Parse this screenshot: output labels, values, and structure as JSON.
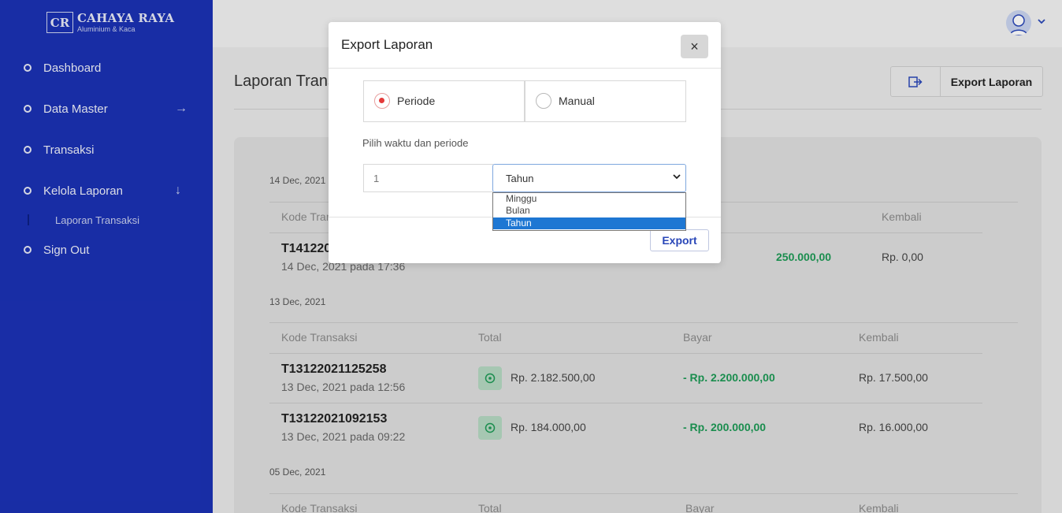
{
  "brand": {
    "logo_mark": "CR",
    "name": "CAHAYA RAYA",
    "tagline": "Aluminium & Kaca"
  },
  "sidebar": {
    "items": [
      {
        "label": "Dashboard",
        "arrow": ""
      },
      {
        "label": "Data Master",
        "arrow": "→"
      },
      {
        "label": "Transaksi",
        "arrow": ""
      },
      {
        "label": "Kelola Laporan",
        "arrow": "↓"
      },
      {
        "label": "Sign Out",
        "arrow": ""
      }
    ],
    "subitem": "Laporan Transaksi"
  },
  "header": {
    "page_title": "Laporan Transaksi",
    "export_button": "Export Laporan",
    "avatar_icon": "user-avatar-icon"
  },
  "report": {
    "columns": {
      "code": "Kode Transaksi",
      "total": "Total",
      "bayar": "Bayar",
      "kembali": "Kembali"
    },
    "groups": [
      {
        "date": "14 Dec, 2021",
        "rows": [
          {
            "code": "T141220",
            "when": "14 Dec, 2021 pada 17:36",
            "bayar": "250.000,00",
            "kembali": "Rp. 0,00"
          }
        ]
      },
      {
        "date": "13 Dec, 2021",
        "rows": [
          {
            "code": "T13122021125258",
            "when": "13 Dec, 2021 pada 12:56",
            "total": "Rp. 2.182.500,00",
            "bayar": "- Rp. 2.200.000,00",
            "kembali": "Rp. 17.500,00"
          },
          {
            "code": "T13122021092153",
            "when": "13 Dec, 2021 pada 09:22",
            "total": "Rp. 184.000,00",
            "bayar": "- Rp. 200.000,00",
            "kembali": "Rp. 16.000,00"
          }
        ]
      },
      {
        "date": "05 Dec, 2021",
        "rows": []
      }
    ]
  },
  "modal": {
    "title": "Export Laporan",
    "close_icon": "×",
    "options": [
      {
        "label": "Periode",
        "checked": true
      },
      {
        "label": "Manual",
        "checked": false
      }
    ],
    "field_label": "Pilih waktu dan periode",
    "amount_value": "1",
    "period_select": {
      "selected": "Tahun",
      "options": [
        "Minggu",
        "Bulan",
        "Tahun"
      ]
    },
    "export_button": "Export"
  },
  "colors": {
    "sidebar": "#1b31b4",
    "accent": "#2a47b8",
    "success": "#1d9a55",
    "radio_checked": "#e43a3a"
  }
}
